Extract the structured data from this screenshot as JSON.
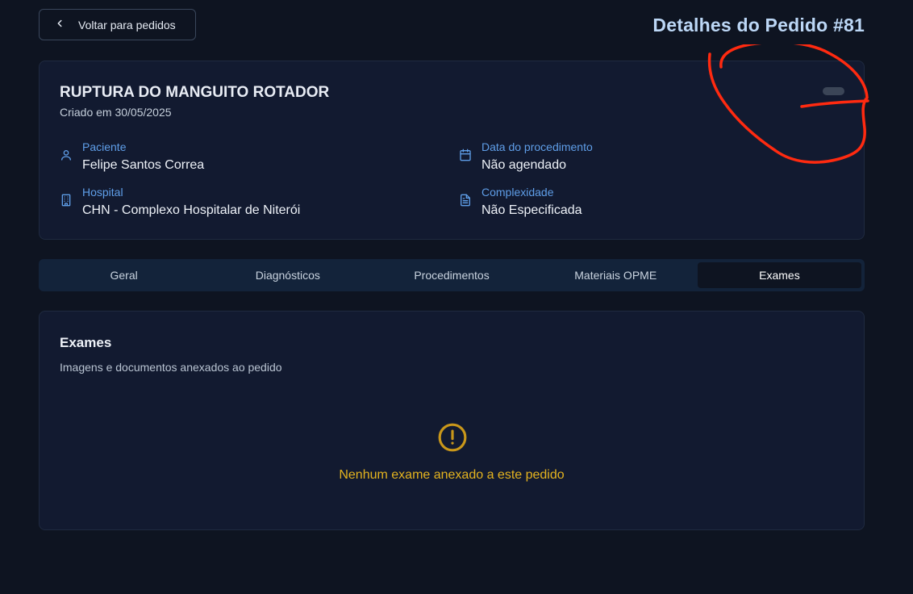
{
  "header": {
    "back_label": "Voltar para pedidos",
    "page_title": "Detalhes do Pedido #81"
  },
  "order": {
    "title": "RUPTURA DO MANGUITO ROTADOR",
    "created": "Criado em 30/05/2025",
    "patient": {
      "label": "Paciente",
      "value": "Felipe Santos Correa",
      "icon": "user-icon"
    },
    "hospital": {
      "label": "Hospital",
      "value": "CHN - Complexo Hospitalar de Niterói",
      "icon": "building-icon"
    },
    "procedure_date": {
      "label": "Data do procedimento",
      "value": "Não agendado",
      "icon": "calendar-icon"
    },
    "complexity": {
      "label": "Complexidade",
      "value": "Não Especificada",
      "icon": "document-icon"
    }
  },
  "tabs": [
    {
      "label": "Geral",
      "active": false
    },
    {
      "label": "Diagnósticos",
      "active": false
    },
    {
      "label": "Procedimentos",
      "active": false
    },
    {
      "label": "Materiais OPME",
      "active": false
    },
    {
      "label": "Exames",
      "active": true
    }
  ],
  "exams": {
    "title": "Exames",
    "subtitle": "Imagens e documentos anexados ao pedido",
    "empty_message": "Nenhum exame anexado a este pedido",
    "empty_icon": "alert-circle-icon"
  },
  "colors": {
    "background": "#0e1421",
    "card": "#121a30",
    "accent_blue": "#5f9ee8",
    "title_blue": "#bcd7f6",
    "warning": "#e4b31f",
    "annotation_red": "#ff2a10"
  }
}
